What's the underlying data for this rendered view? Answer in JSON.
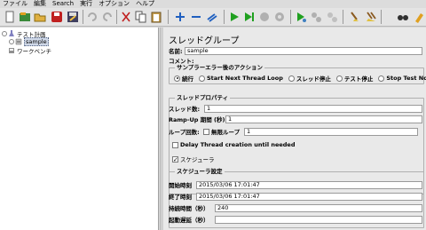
{
  "menu": [
    "ファイル",
    "編集",
    "Search",
    "実行",
    "オプション",
    "ヘルプ"
  ],
  "toolbar_icons": [
    "new-icon",
    "templates-icon",
    "open-icon",
    "close-icon",
    "save-icon",
    "undo-icon",
    "redo-icon",
    "cut-icon",
    "copy-icon",
    "paste-icon",
    "expand-icon",
    "collapse-icon",
    "toggle-icon",
    "start-icon",
    "start-no-pause-icon",
    "stop-icon",
    "shutdown-icon",
    "remote-start-icon",
    "remote-stop-icon",
    "remote-shutdown-icon",
    "clear-icon",
    "clear-all-icon",
    "search-icon",
    "reset-search-icon"
  ],
  "tree": {
    "test_plan": "テスト計画",
    "thread_group": "sample",
    "workbench": "ワークベンチ"
  },
  "panel": {
    "title": "スレッドグループ",
    "name_label": "名前:",
    "name_value": "sample",
    "comment_label": "コメント:",
    "action": {
      "title": "サンプラーエラー後のアクション",
      "options": [
        "続行",
        "Start Next Thread Loop",
        "スレッド停止",
        "テスト停止",
        "Stop Test Now"
      ],
      "selected": 0
    },
    "props": {
      "title": "スレッドプロパティ",
      "threads_label": "スレッド数:",
      "threads_value": "1",
      "rampup_label": "Ramp-Up 期間 (秒):",
      "rampup_value": "1",
      "loop_label": "ループ回数:",
      "infinite_label": "無限ループ",
      "loop_value": "1",
      "delay_label": "Delay Thread creation until needed",
      "scheduler_label": "スケジューラ",
      "scheduler_checked": true
    },
    "schedule": {
      "title": "スケジューラ設定",
      "start_label": "開始時刻",
      "start_value": "2015/03/06 17:01:47",
      "end_label": "終了時刻",
      "end_value": "2015/03/06 17:01:47",
      "duration_label": "持続時間（秒）",
      "duration_value": "240",
      "delay_label": "起動遅延（秒）",
      "delay_value": ""
    }
  }
}
